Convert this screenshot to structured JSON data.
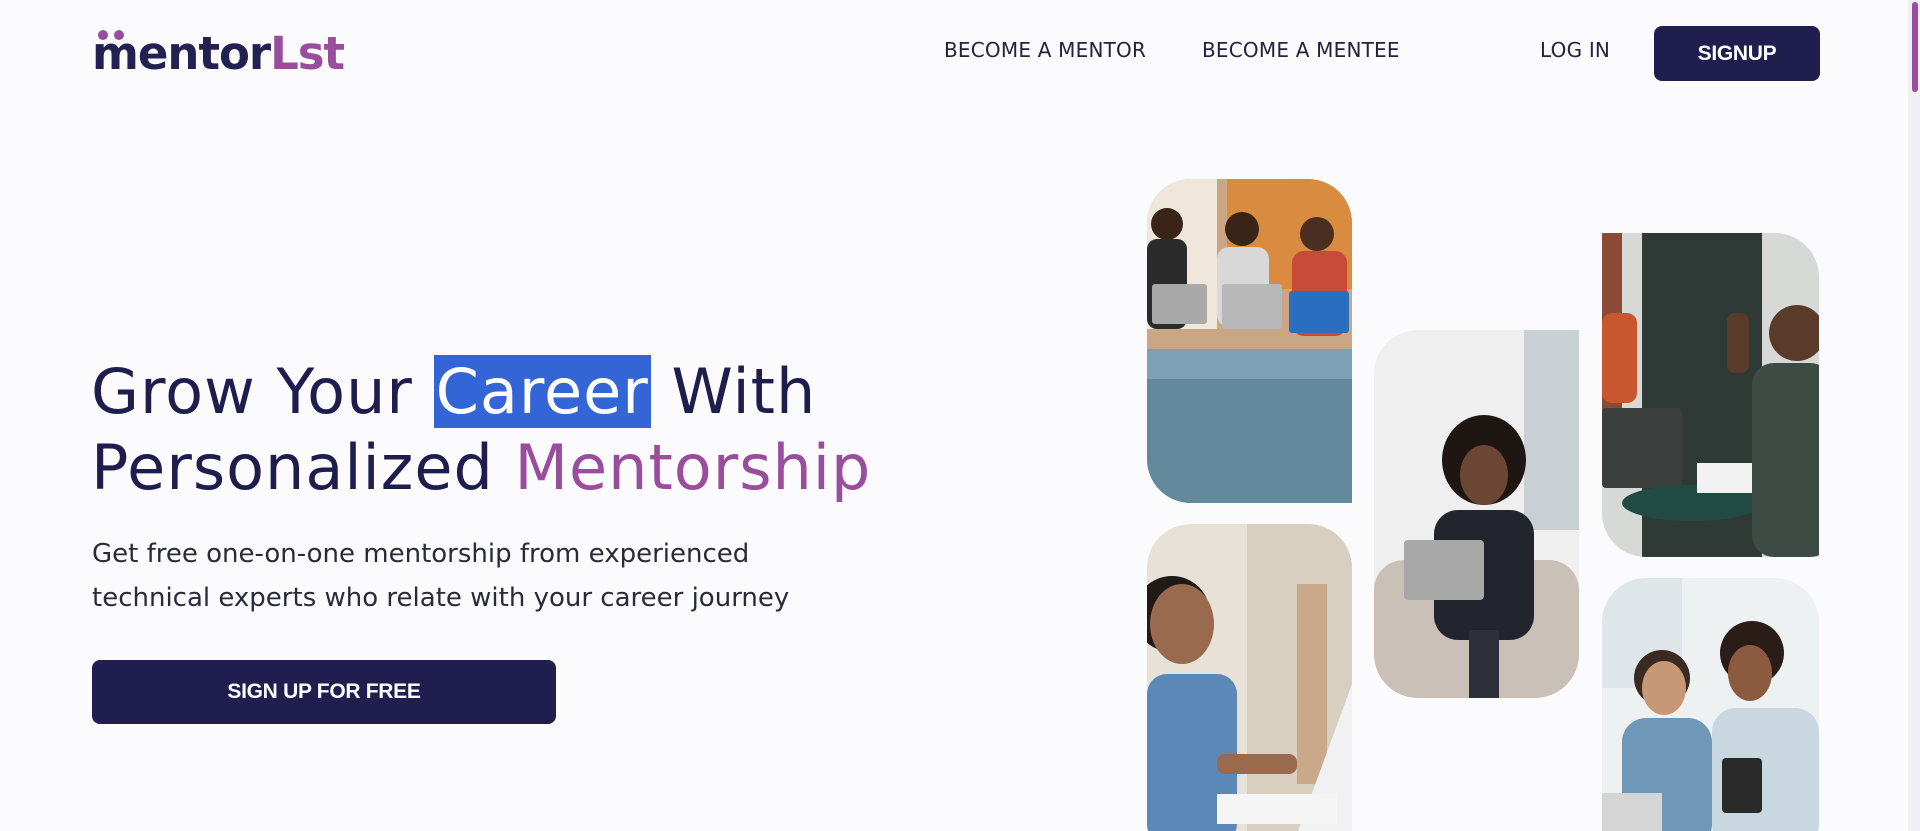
{
  "logo": {
    "part1": "mentor",
    "part2": "Lst"
  },
  "nav": {
    "become_mentor": "BECOME A MENTOR",
    "become_mentee": "BECOME A MENTEE",
    "login": "LOG IN",
    "signup": "SIGNUP"
  },
  "hero": {
    "headline_line1_a": "Grow Your ",
    "headline_highlight": "Career",
    "headline_line1_b": " With",
    "headline_line2_a": "Personalized ",
    "headline_line2_accent": "Mentorship",
    "subtext_line1": "Get free one-on-one mentorship from experienced",
    "subtext_line2": "technical experts who relate with your career journey",
    "cta": "SIGN UP FOR FREE"
  },
  "colors": {
    "primary": "#201e4f",
    "accent": "#9a4d9d",
    "selection": "#3465d6",
    "background": "#fbfbfd"
  }
}
